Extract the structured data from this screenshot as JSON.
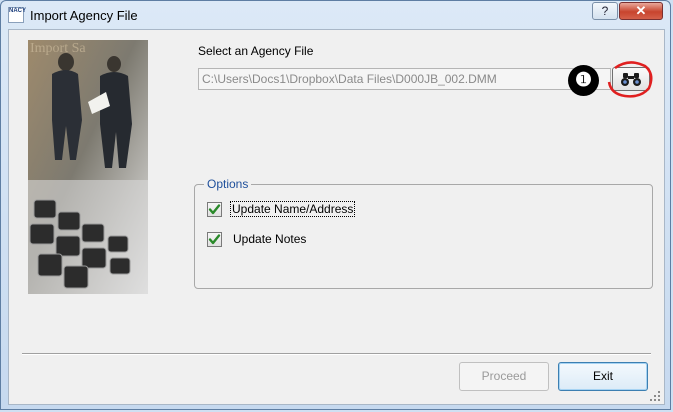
{
  "window": {
    "title": "Import Agency File",
    "icon_text": "NACY",
    "help_glyph": "?",
    "close_glyph": "✕"
  },
  "file_select": {
    "label": "Select an Agency File",
    "path_value": "C:\\Users\\Docs1\\Dropbox\\Data Files\\D000JB_002.DMM",
    "browse_icon": "binoculars-icon",
    "callout_number": "❶"
  },
  "side_image": {
    "watermark_text": "Import Sa"
  },
  "options": {
    "legend": "Options",
    "items": [
      {
        "label": "Update Name/Address",
        "checked": true
      },
      {
        "label": "Update Notes",
        "checked": true
      }
    ]
  },
  "buttons": {
    "proceed_label": "Proceed",
    "exit_label": "Exit"
  }
}
